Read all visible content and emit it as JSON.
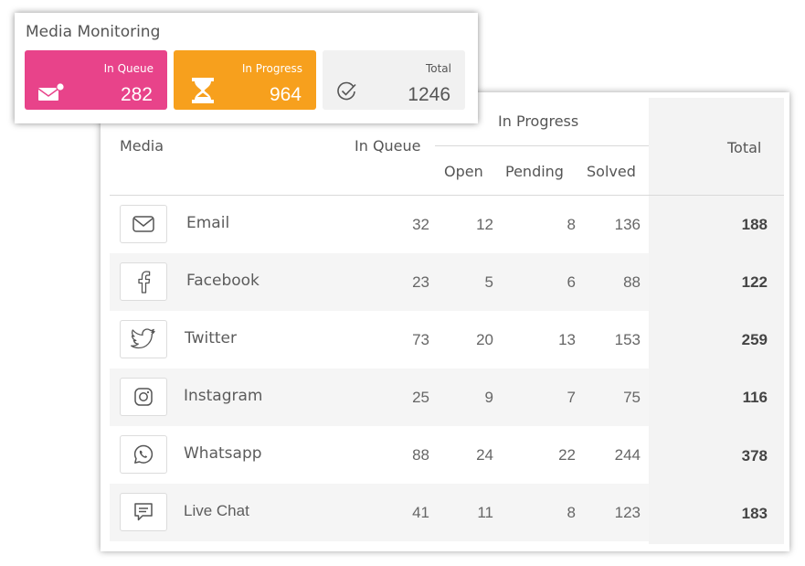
{
  "monitoring": {
    "title": "Media Monitoring",
    "tiles": [
      {
        "label": "In Queue",
        "value": "282",
        "icon": "envelope-notification-icon",
        "color": "#e8438a"
      },
      {
        "label": "In Progress",
        "value": "964",
        "icon": "hourglass-icon",
        "color": "#f7a01d"
      },
      {
        "label": "Total",
        "value": "1246",
        "icon": "check-circle-icon",
        "color": "#f1f1f1"
      }
    ]
  },
  "table": {
    "headers": {
      "media": "Media",
      "in_queue": "In Queue",
      "in_progress": "In Progress",
      "open": "Open",
      "pending": "Pending",
      "solved": "Solved",
      "total": "Total"
    },
    "rows": [
      {
        "name": "Email",
        "icon": "envelope-icon",
        "in_queue": "32",
        "open": "12",
        "pending": "8",
        "solved": "136",
        "total": "188"
      },
      {
        "name": "Facebook",
        "icon": "facebook-icon",
        "in_queue": "23",
        "open": "5",
        "pending": "6",
        "solved": "88",
        "total": "122"
      },
      {
        "name": "Twitter",
        "icon": "twitter-icon",
        "in_queue": "73",
        "open": "20",
        "pending": "13",
        "solved": "153",
        "total": "259"
      },
      {
        "name": "Instagram",
        "icon": "instagram-icon",
        "in_queue": "25",
        "open": "9",
        "pending": "7",
        "solved": "75",
        "total": "116"
      },
      {
        "name": "Whatsapp",
        "icon": "whatsapp-icon",
        "in_queue": "88",
        "open": "24",
        "pending": "22",
        "solved": "244",
        "total": "378"
      },
      {
        "name": "Live Chat",
        "icon": "chat-icon",
        "in_queue": "41",
        "open": "11",
        "pending": "8",
        "solved": "123",
        "total": "183"
      }
    ]
  }
}
